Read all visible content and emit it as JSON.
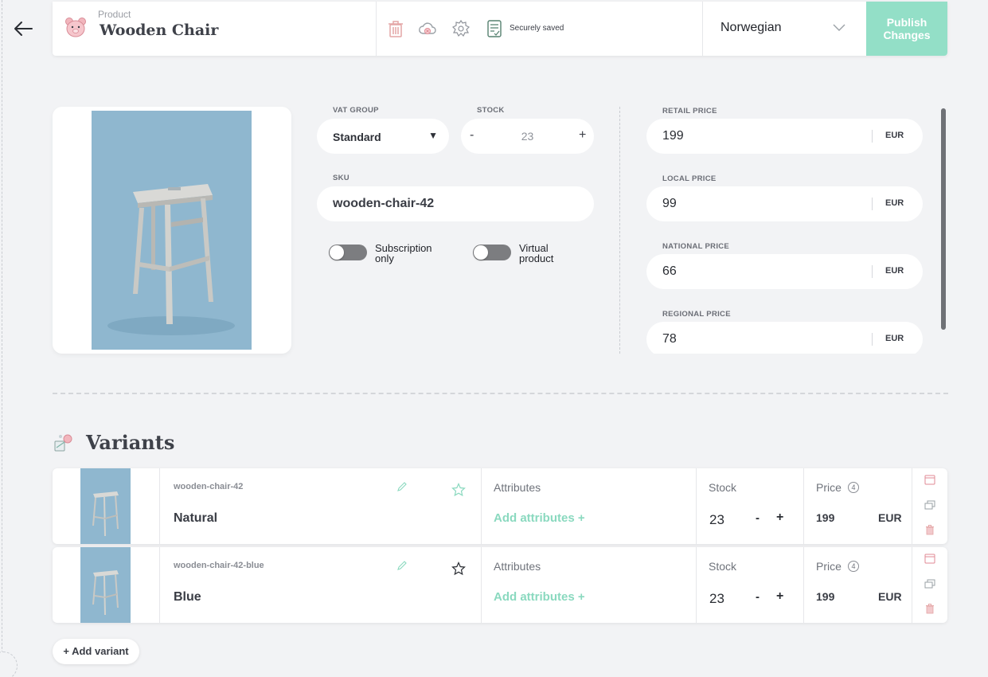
{
  "header": {
    "kicker": "Product",
    "title": "Wooden Chair",
    "saved_status": "Securely saved",
    "language": "Norwegian",
    "publish_label": "Publish Changes"
  },
  "product": {
    "vat_label": "VAT GROUP",
    "vat_value": "Standard",
    "stock_label": "STOCK",
    "stock_minus": "-",
    "stock_value": "23",
    "stock_plus": "+",
    "sku_label": "SKU",
    "sku_value": "wooden-chair-42",
    "subscription_label": "Subscription only",
    "virtual_label": "Virtual product",
    "subscription_on": false,
    "virtual_on": false
  },
  "prices": [
    {
      "label": "RETAIL PRICE",
      "value": "199",
      "currency": "EUR"
    },
    {
      "label": "LOCAL PRICE",
      "value": "99",
      "currency": "EUR"
    },
    {
      "label": "NATIONAL PRICE",
      "value": "66",
      "currency": "EUR"
    },
    {
      "label": "REGIONAL PRICE",
      "value": "78",
      "currency": "EUR"
    }
  ],
  "variants": {
    "title": "Variants",
    "add_label": "+ Add variant",
    "attributes_label": "Attributes",
    "add_attributes_label": "Add attributes +",
    "stock_label": "Stock",
    "price_label": "Price",
    "price_info": "4",
    "items": [
      {
        "sku": "wooden-chair-42",
        "name": "Natural",
        "stock": "23",
        "price": "199",
        "currency": "EUR",
        "starred": true
      },
      {
        "sku": "wooden-chair-42-blue",
        "name": "Blue",
        "stock": "23",
        "price": "199",
        "currency": "EUR",
        "starred": false
      }
    ]
  },
  "colors": {
    "accent": "#93dfc7",
    "accent_text": "#8ad9bf",
    "background": "#f2f3f5",
    "delete_icon": "#e4a6a6"
  },
  "icons": {
    "back": "arrow-left-icon",
    "logo": "bear-logo-icon",
    "delete": "trash-icon",
    "unpublish": "cloud-x-icon",
    "settings": "gear-icon",
    "saved": "document-check-icon",
    "edit": "pencil-icon",
    "favorite": "star-icon",
    "calendar": "calendar-icon",
    "duplicate": "copy-icon"
  }
}
